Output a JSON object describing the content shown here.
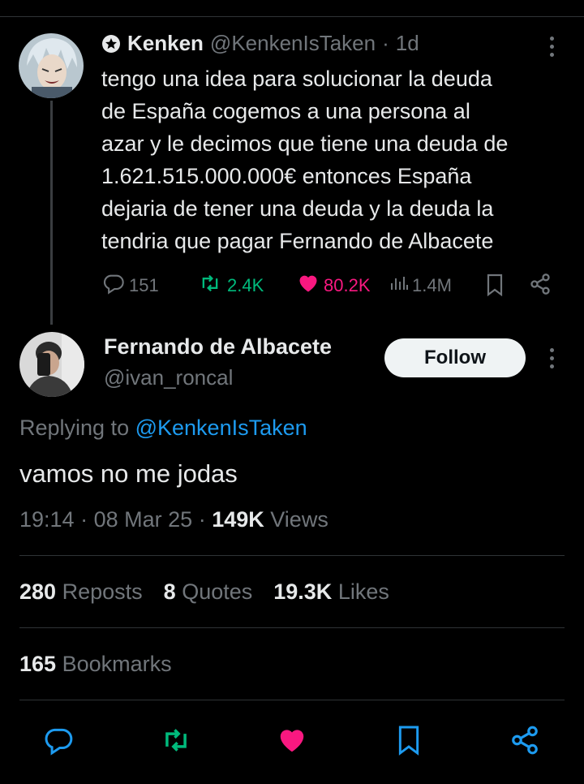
{
  "quoted_tweet": {
    "display_name": "Kenken",
    "handle": "@KenkenIsTaken",
    "separator": "·",
    "time": "1d",
    "text_lines": [
      "tengo una idea para solucionar la deuda",
      "de España cogemos a una persona al",
      "azar y le decimos que tiene una deuda de",
      "1.621.515.000.000€ entonces España",
      "dejaria de tener una deuda y la deuda la",
      "tendria que pagar Fernando de Albacete"
    ],
    "replies": "151",
    "reposts": "2.4K",
    "likes": "80.2K",
    "views": "1.4M"
  },
  "reply_tweet": {
    "display_name": "Fernando de Albacete",
    "handle": "@ivan_roncal",
    "follow_label": "Follow",
    "replying_prefix": "Replying to",
    "replying_handle": "@KenkenIsTaken",
    "text": "vamos no me jodas",
    "time": "19:14",
    "date": "08 Mar 25",
    "separator": "·",
    "views_count": "149K",
    "views_label": "Views"
  },
  "stats": {
    "reposts_count": "280",
    "reposts_label": "Reposts",
    "quotes_count": "8",
    "quotes_label": "Quotes",
    "likes_count": "19.3K",
    "likes_label": "Likes",
    "bookmarks_count": "165",
    "bookmarks_label": "Bookmarks"
  },
  "colors": {
    "repost_green": "#00ba7c",
    "like_pink": "#f91880",
    "link_blue": "#1d9bf0"
  }
}
